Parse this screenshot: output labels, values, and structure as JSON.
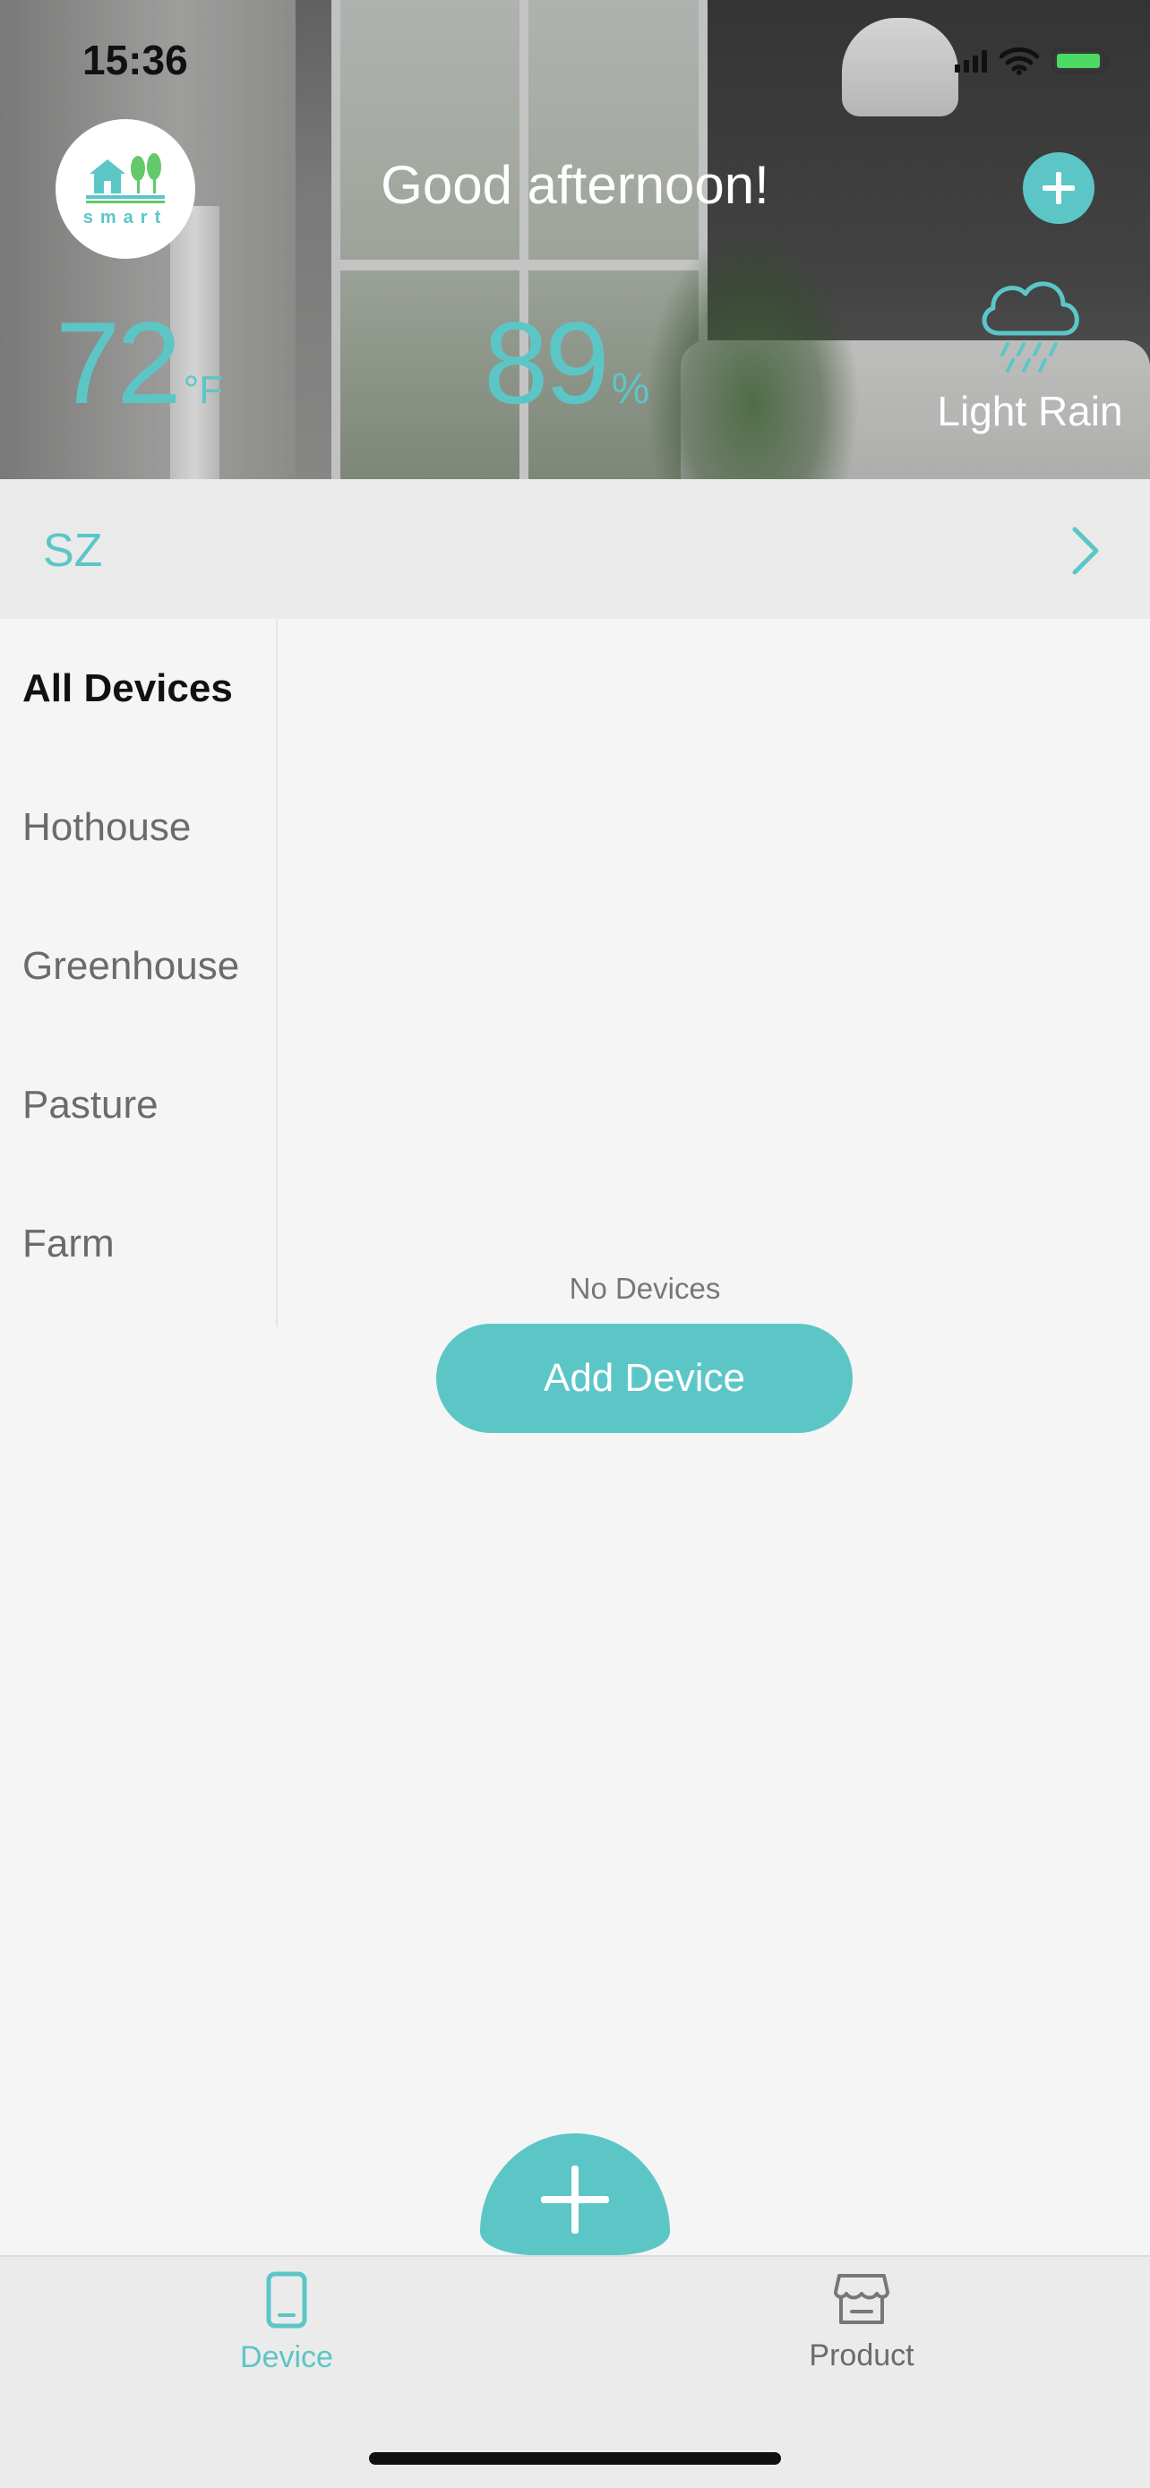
{
  "status_bar": {
    "time": "15:36",
    "icons": [
      "cellular-signal-icon",
      "wifi-icon",
      "battery-charging-icon"
    ]
  },
  "header": {
    "logo_text": "smart",
    "greeting": "Good afternoon!",
    "add_icon": "plus-icon",
    "temperature": {
      "value": "72",
      "unit": "°F"
    },
    "humidity": {
      "value": "89",
      "unit": "%"
    },
    "weather": {
      "icon": "rain-cloud-icon",
      "label": "Light Rain"
    }
  },
  "location": {
    "name": "SZ",
    "icon": "chevron-right-icon"
  },
  "sidebar": {
    "items": [
      {
        "label": "All Devices",
        "active": true
      },
      {
        "label": "Hothouse",
        "active": false
      },
      {
        "label": "Greenhouse",
        "active": false
      },
      {
        "label": "Pasture",
        "active": false
      },
      {
        "label": "Farm",
        "active": false
      }
    ]
  },
  "content": {
    "empty_text": "No Devices",
    "add_button": "Add Device"
  },
  "tabbar": {
    "tabs": [
      {
        "label": "Device",
        "icon": "phone-device-icon",
        "active": true
      },
      {
        "label": "Product",
        "icon": "store-icon",
        "active": false
      }
    ],
    "center_icon": "plus-icon"
  },
  "colors": {
    "accent": "#5cc6c7",
    "active_text": "#111111",
    "inactive_text": "#6b6b6b",
    "background": "#f5f5f5"
  }
}
